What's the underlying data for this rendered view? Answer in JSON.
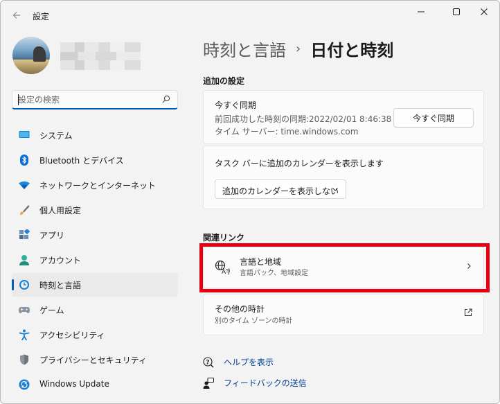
{
  "window": {
    "app_title": "設定",
    "icons": {
      "back": "back-arrow-icon",
      "minimize": "minimize-icon",
      "maximize": "maximize-icon",
      "close": "close-icon"
    }
  },
  "user": {
    "avatar": "avatar-image"
  },
  "search": {
    "placeholder": "設定の検索",
    "value": ""
  },
  "sidebar": {
    "items": [
      {
        "label": "システム",
        "icon": "system-display-icon",
        "active": false
      },
      {
        "label": "Bluetooth とデバイス",
        "icon": "bluetooth-icon",
        "active": false
      },
      {
        "label": "ネットワークとインターネット",
        "icon": "wifi-icon",
        "active": false
      },
      {
        "label": "個人用設定",
        "icon": "brush-icon",
        "active": false
      },
      {
        "label": "アプリ",
        "icon": "apps-icon",
        "active": false
      },
      {
        "label": "アカウント",
        "icon": "account-icon",
        "active": false
      },
      {
        "label": "時刻と言語",
        "icon": "time-language-icon",
        "active": true
      },
      {
        "label": "ゲーム",
        "icon": "gamepad-icon",
        "active": false
      },
      {
        "label": "アクセシビリティ",
        "icon": "accessibility-icon",
        "active": false
      },
      {
        "label": "プライバシーとセキュリティ",
        "icon": "shield-icon",
        "active": false
      },
      {
        "label": "Windows Update",
        "icon": "windows-update-icon",
        "active": false
      }
    ]
  },
  "breadcrumb": {
    "parent": "時刻と言語",
    "separator": "›",
    "current": "日付と時刻"
  },
  "additional": {
    "heading": "追加の設定",
    "sync": {
      "title": "今すぐ同期",
      "last_sync": "前回成功した時刻の同期:2022/02/01 8:46:38",
      "server": "タイム サーバー: time.windows.com",
      "button": "今すぐ同期"
    },
    "calendar": {
      "label": "タスク バーに追加のカレンダーを表示します",
      "selected": "追加のカレンダーを表示しない"
    }
  },
  "related": {
    "heading": "関連リンク",
    "language_region": {
      "title": "言語と地域",
      "subtitle": "言語パック、地域設定",
      "icon": "language-icon"
    },
    "other_clocks": {
      "title": "その他の時計",
      "subtitle": "別のタイム ゾーンの時計",
      "icon": "external-link-icon"
    }
  },
  "help": {
    "show_help": "ヘルプを表示",
    "feedback": "フィードバックの送信"
  },
  "colors": {
    "accent": "#005fb8",
    "highlight_box": "#e60012",
    "link": "#003e92"
  }
}
